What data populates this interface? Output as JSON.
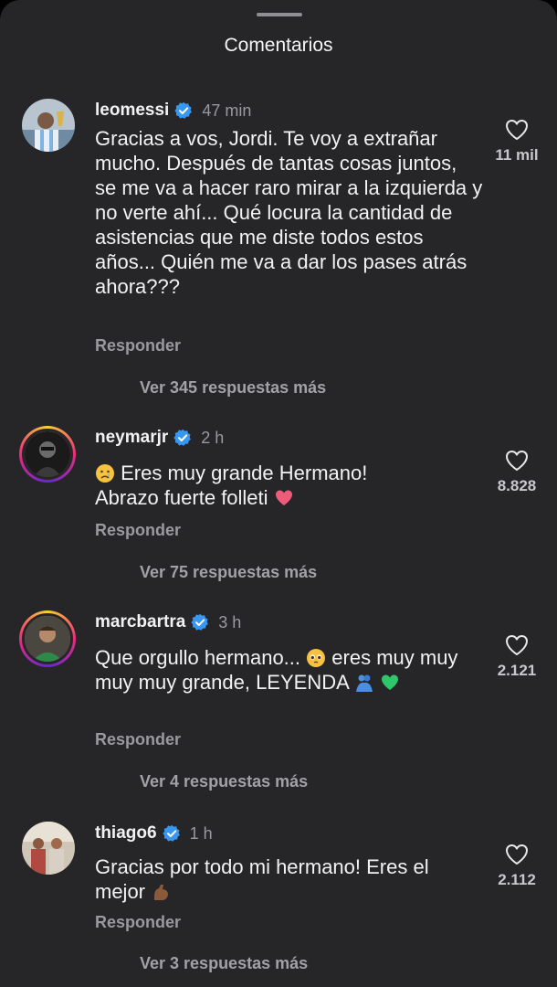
{
  "header": {
    "title": "Comentarios"
  },
  "comments": [
    {
      "username": "leomessi",
      "time": "47 min",
      "text": "Gracias a vos, Jordi. Te voy a extrañar mucho. Después de tantas cosas juntos, se me va a hacer raro mirar a la izquierda y no verte ahí... Qué locura la cantidad de asistencias que me diste todos estos años... Quién me va a dar los pases atrás ahora???",
      "reply_label": "Responder",
      "likes": "11 mil",
      "more_replies": "Ver 345 respuestas más"
    },
    {
      "username": "neymarjr",
      "time": "2 h",
      "text_line1": "Eres muy grande Hermano!",
      "text_line2": "Abrazo fuerte folleti",
      "reply_label": "Responder",
      "likes": "8.828",
      "more_replies": "Ver 75 respuestas más"
    },
    {
      "username": "marcbartra",
      "time": "3 h",
      "text_part1": "Que orgullo hermano...",
      "text_part2": "eres muy muy muy muy grande, LEYENDA",
      "reply_label": "Responder",
      "likes": "2.121",
      "more_replies": "Ver 4 respuestas más"
    },
    {
      "username": "thiago6",
      "time": "1 h",
      "text": "Gracias por todo mi hermano! Eres el mejor",
      "reply_label": "Responder",
      "likes": "2.112",
      "more_replies": "Ver 3 respuestas más"
    }
  ],
  "colors": {
    "background": "#262629",
    "verified": "#3897f0",
    "muted": "#9a9a9e"
  }
}
